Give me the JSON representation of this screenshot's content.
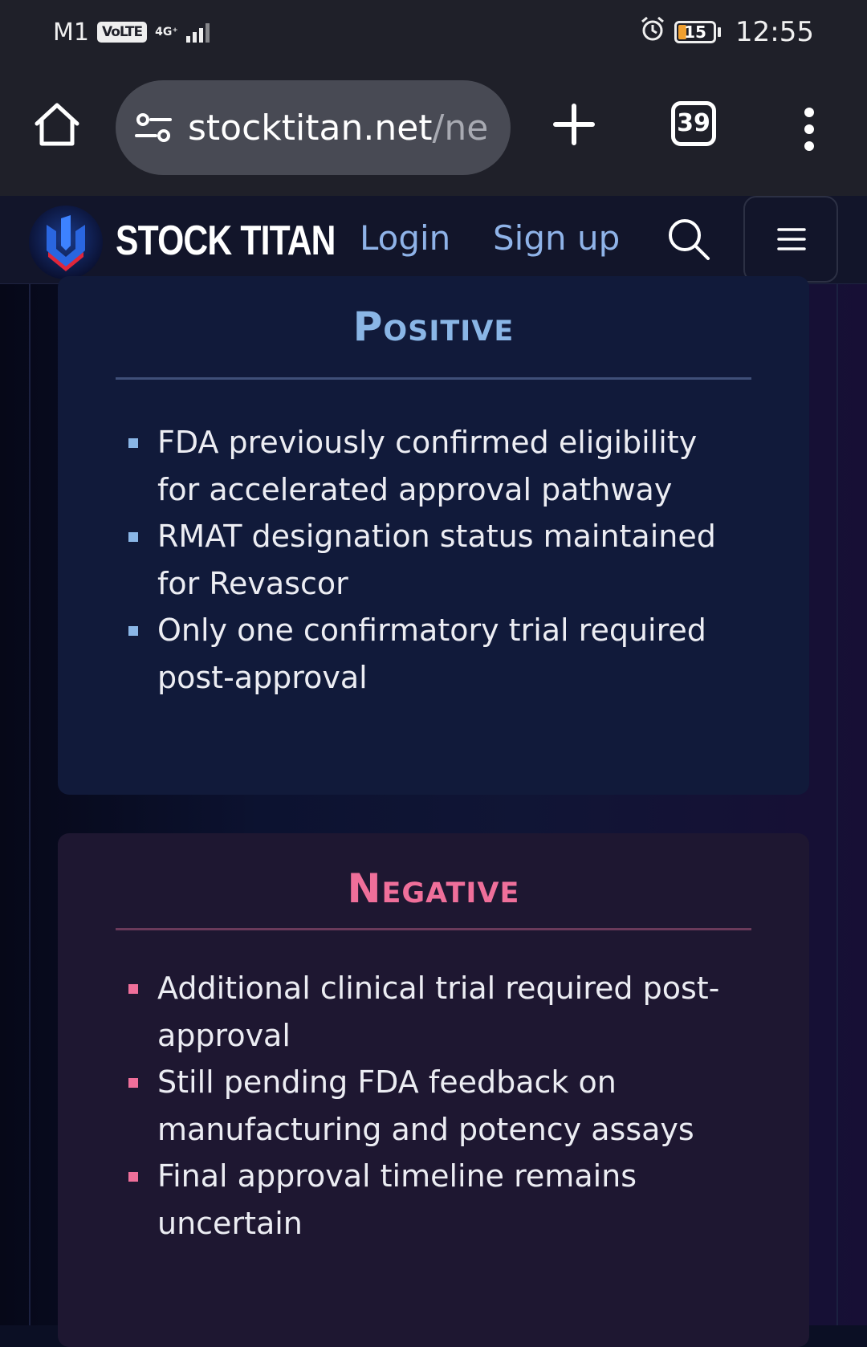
{
  "status_bar": {
    "carrier": "M1",
    "volte": "VoLTE",
    "network": "4G⁺",
    "battery": "15",
    "time": "12:55"
  },
  "browser": {
    "url_main": "stocktitan.net",
    "url_rest": "/ne",
    "tab_count": "39"
  },
  "site_header": {
    "brand": "STOCK TITAN",
    "login": "Login",
    "signup": "Sign up"
  },
  "positive": {
    "title": "Positive",
    "accent": "#8ab6e6",
    "items": [
      "FDA previously confirmed eligibility for accelerated approval pathway",
      "RMAT designation status maintained for Revascor",
      "Only one confirmatory trial required post-approval"
    ]
  },
  "negative": {
    "title": "Negative",
    "accent": "#ef6f9a",
    "items": [
      "Additional clinical trial required post-approval",
      "Still pending FDA feedback on manufacturing and potency assays",
      "Final approval timeline remains uncertain"
    ]
  },
  "icons": [
    "home-icon",
    "site-info-icon",
    "plus-icon",
    "tabs-icon",
    "more-vert-icon",
    "search-icon",
    "hamburger-menu-icon",
    "alarm-icon",
    "signal-icon",
    "battery-icon"
  ]
}
